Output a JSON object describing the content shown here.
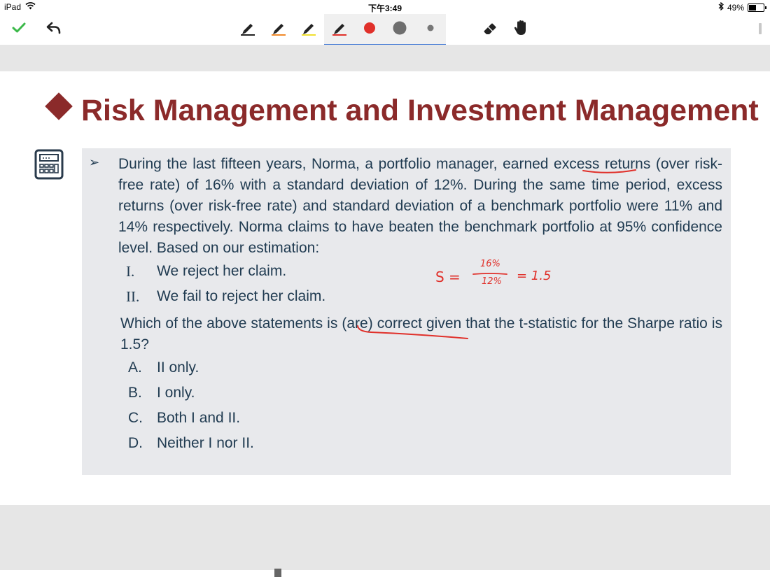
{
  "status": {
    "device": "iPad",
    "time": "下午3:49",
    "battery": "49%",
    "battery_level": 0.49
  },
  "toolbar": {
    "icons": [
      "check-icon",
      "undo-icon",
      "pen-black-icon",
      "pen-orange-icon",
      "pen-yellow-icon",
      "pen-red-icon",
      "color-red-dot-icon",
      "size-large-dot-icon",
      "size-small-dot-icon",
      "eraser-icon",
      "hand-icon"
    ],
    "colors": {
      "check": "#3cb94a",
      "pen_black": "#222222",
      "pen_orange": "#f08a2a",
      "pen_yellow": "#f0e030",
      "pen_red": "#e0302a",
      "selected_accent": "#4a7fd6"
    }
  },
  "slide": {
    "title": "Risk Management and Investment Management",
    "title_color": "#8b2a2a",
    "icon": "calculator-icon",
    "question": "During the last fifteen years, Norma, a portfolio manager, earned excess returns (over risk-free rate) of 16% with a standard deviation of 12%. During the same time period, excess returns (over risk-free rate) and standard deviation of a benchmark portfolio were 11% and 14% respectively. Norma claims to have beaten the benchmark portfolio at 95% confidence level. Based on our estimation:",
    "statements": [
      {
        "num": "I.",
        "text": "We reject her claim."
      },
      {
        "num": "II.",
        "text": "We fail to reject her claim."
      }
    ],
    "prompt": "Which of the above statements is (are) correct given that the t-statistic for the Sharpe ratio is 1.5?",
    "options": [
      {
        "num": "A.",
        "text": "II only."
      },
      {
        "num": "B.",
        "text": "I only."
      },
      {
        "num": "C.",
        "text": "Both I and II."
      },
      {
        "num": "D.",
        "text": "Neither I nor II."
      }
    ]
  },
  "annotations": {
    "sharpe_symbol": "S =",
    "numerator": "16%",
    "denominator": "12%",
    "result": "= 1.5",
    "ink_color": "#e0302a"
  }
}
